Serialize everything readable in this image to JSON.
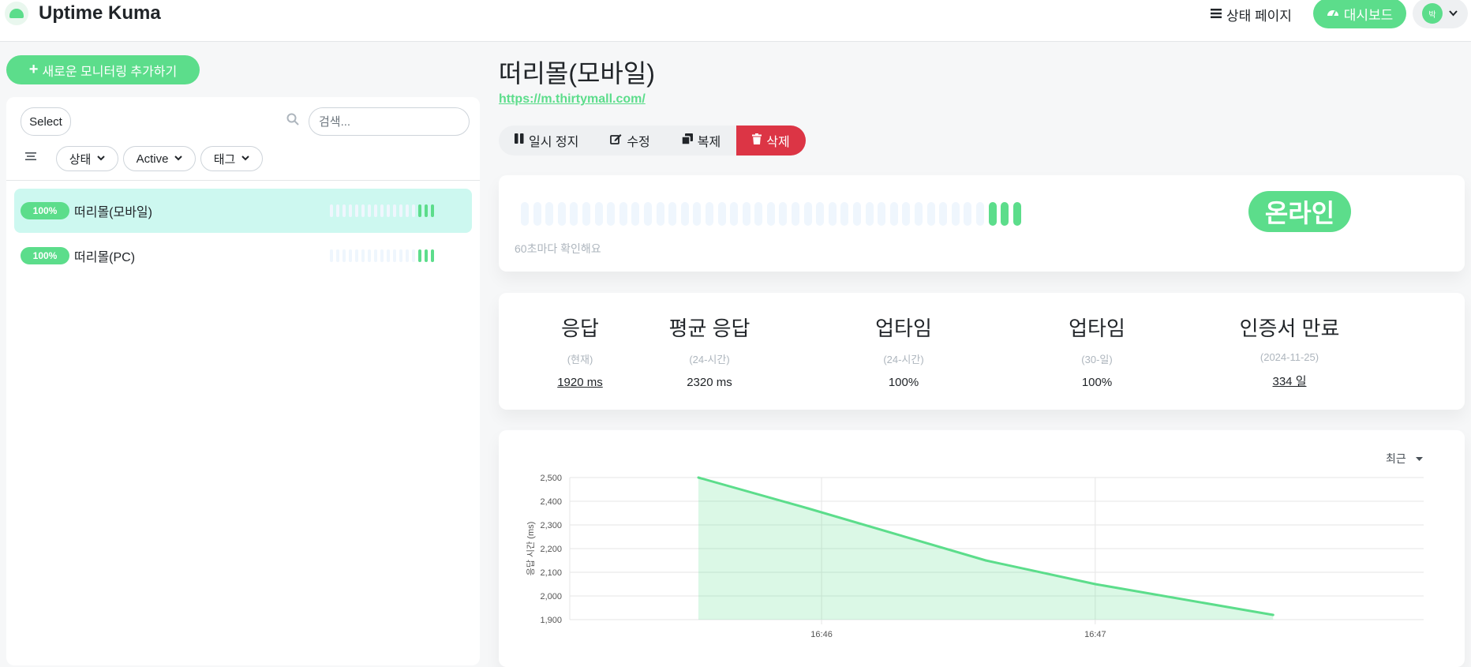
{
  "header": {
    "app_name": "Uptime Kuma",
    "status_page_label": "상태 페이지",
    "dashboard_label": "대시보드",
    "avatar_initial": "박"
  },
  "sidebar": {
    "add_monitor_label": "새로운 모니터링 추가하기",
    "select_label": "Select",
    "search_placeholder": "검색...",
    "filters": [
      "상태",
      "Active",
      "태그"
    ],
    "monitors": [
      {
        "uptime": "100%",
        "name": "떠리몰(모바일)",
        "active": true,
        "beats_total": 17,
        "beats_up": 3
      },
      {
        "uptime": "100%",
        "name": "떠리몰(PC)",
        "active": false,
        "beats_total": 17,
        "beats_up": 3
      }
    ]
  },
  "main": {
    "title": "떠리몰(모바일)",
    "url": "https://m.thirtymall.com/",
    "actions": {
      "pause": "일시 정지",
      "edit": "수정",
      "clone": "복제",
      "delete": "삭제"
    },
    "beats": {
      "empty": 38,
      "up": 3
    },
    "interval_text": "60초마다 확인해요",
    "status": "온라인",
    "stats": [
      {
        "title": "응답",
        "sub": "(현재)",
        "value": "1920 ms",
        "underline": true
      },
      {
        "title": "평균 응답",
        "sub": "(24-시간)",
        "value": "2320 ms",
        "underline": false
      },
      {
        "title": "업타임",
        "sub": "(24-시간)",
        "value": "100%",
        "underline": false
      },
      {
        "title": "업타임",
        "sub": "(30-일)",
        "value": "100%",
        "underline": false
      },
      {
        "title": "인증서 만료",
        "sub": "(2024-11-25)",
        "value": "334 일",
        "underline": true
      }
    ],
    "period_label": "최근"
  },
  "colors": {
    "primary": "#5cdd8b",
    "danger": "#dc3545",
    "empty_beat": "#eff6fd",
    "selected_item": "#cdf8f0"
  },
  "chart_data": {
    "type": "area",
    "ylabel": "응답 시간 (ms)",
    "xlabel": "",
    "ylim": [
      1900,
      2500
    ],
    "yticks": [
      1900,
      2000,
      2100,
      2200,
      2300,
      2400,
      2500
    ],
    "ytick_labels": [
      "1,900",
      "2,000",
      "2,100",
      "2,200",
      "2,300",
      "2,400",
      "2,500"
    ],
    "xticks": [
      {
        "t": 46,
        "label": "16:46"
      },
      {
        "t": 47,
        "label": "16:47"
      }
    ],
    "xlim": [
      45.08,
      48.2
    ],
    "series": [
      {
        "points": [
          [
            45.55,
            2500
          ],
          [
            45.95,
            2370
          ],
          [
            46.6,
            2150
          ],
          [
            47.0,
            2050
          ],
          [
            47.65,
            1920
          ]
        ]
      }
    ]
  }
}
